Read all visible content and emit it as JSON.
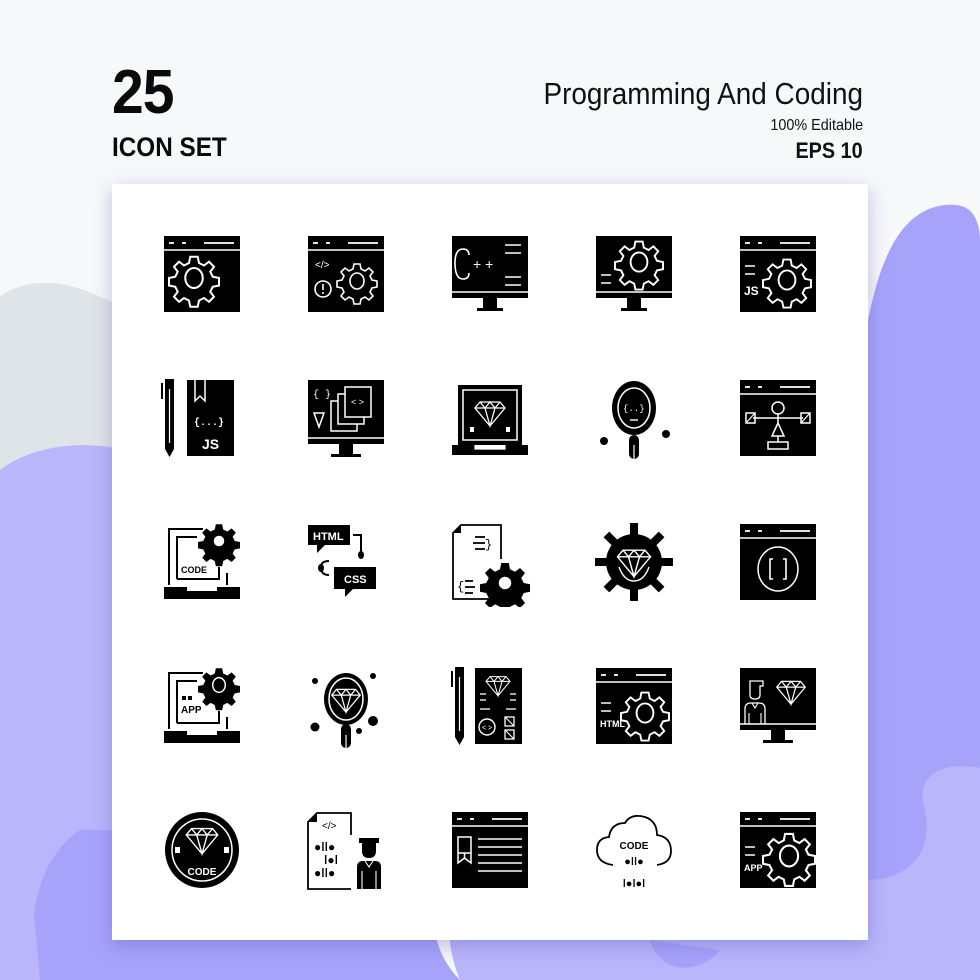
{
  "header": {
    "count": "25",
    "set_label": "ICON SET",
    "title": "Programming And Coding",
    "editable": "100% Editable",
    "format": "EPS 10"
  },
  "colors": {
    "background": "#f7f8fa",
    "blob_gray": "#dfe4e8",
    "blob_lavender": "#b9b6fb",
    "blob_purple": "#a7a3fb",
    "card": "#ffffff",
    "icon": "#000000"
  },
  "icons": [
    {
      "name": "browser-gear-icon"
    },
    {
      "name": "browser-code-warning-gear-icon"
    },
    {
      "name": "monitor-cplusplus-icon",
      "text": "C++"
    },
    {
      "name": "monitor-gear-icon"
    },
    {
      "name": "browser-js-gear-icon",
      "text": "JS"
    },
    {
      "name": "pen-js-book-icon",
      "text": "JS"
    },
    {
      "name": "monitor-code-layers-icon"
    },
    {
      "name": "laptop-diamond-icon"
    },
    {
      "name": "magnifier-code-icon"
    },
    {
      "name": "browser-flowchart-icon"
    },
    {
      "name": "laptop-code-gear-icon",
      "text": "CODE"
    },
    {
      "name": "html-css-chat-icon",
      "text_a": "HTML",
      "text_b": "CSS"
    },
    {
      "name": "document-code-gear-icon"
    },
    {
      "name": "gear-diamond-icon"
    },
    {
      "name": "browser-brackets-icon"
    },
    {
      "name": "laptop-app-gear-icon",
      "text": "APP"
    },
    {
      "name": "magnifier-diamond-icon"
    },
    {
      "name": "pen-diamond-document-icon"
    },
    {
      "name": "browser-html-gear-icon",
      "text": "HTML"
    },
    {
      "name": "monitor-developer-diamond-icon"
    },
    {
      "name": "code-diamond-badge-icon",
      "text": "CODE"
    },
    {
      "name": "document-binary-developer-icon"
    },
    {
      "name": "browser-bookmark-text-icon"
    },
    {
      "name": "cloud-code-binary-icon",
      "text": "CODE"
    },
    {
      "name": "browser-app-gear-icon",
      "text": "APP"
    }
  ]
}
